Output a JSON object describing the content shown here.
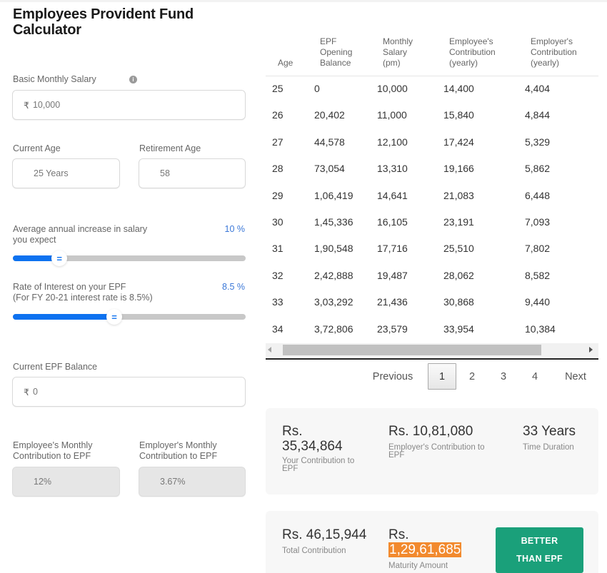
{
  "title": "Employees Provident Fund Calculator",
  "form": {
    "basic_salary": {
      "label": "Basic Monthly Salary",
      "currency": "₹",
      "value": "10,000",
      "info_icon": "i"
    },
    "current_age": {
      "label": "Current Age",
      "value": "25 Years"
    },
    "retirement_age": {
      "label": "Retirement Age",
      "value": "58"
    },
    "salary_increase": {
      "label_line1": "Average annual increase in salary",
      "label_line2": "you expect",
      "value_text": "10 %",
      "value": 10
    },
    "interest_rate": {
      "label_line1": "Rate of Interest on your EPF",
      "label_line2": "(For FY 20-21 interest rate is 8.5%)",
      "value_text": "8.5 %",
      "value": 8.5
    },
    "current_balance": {
      "label": "Current EPF Balance",
      "currency": "₹",
      "value": "0"
    },
    "employee_contribution": {
      "label_line1": "Employee's Monthly",
      "label_line2": "Contribution to EPF",
      "value": "12%"
    },
    "employer_contribution": {
      "label_line1": "Employer's Monthly",
      "label_line2": "Contribution to EPF",
      "value": "3.67%"
    }
  },
  "table": {
    "headers": [
      [
        "Age"
      ],
      [
        "EPF",
        "Opening",
        "Balance"
      ],
      [
        "Monthly",
        "Salary",
        "(pm)"
      ],
      [
        "Employee's",
        "Contribution",
        "(yearly)"
      ],
      [
        "Employer's",
        "Contribution",
        "(yearly)"
      ]
    ],
    "rows": [
      [
        "25",
        "0",
        "10,000",
        "14,400",
        "4,404"
      ],
      [
        "26",
        "20,402",
        "11,000",
        "15,840",
        "4,844"
      ],
      [
        "27",
        "44,578",
        "12,100",
        "17,424",
        "5,329"
      ],
      [
        "28",
        "73,054",
        "13,310",
        "19,166",
        "5,862"
      ],
      [
        "29",
        "1,06,419",
        "14,641",
        "21,083",
        "6,448"
      ],
      [
        "30",
        "1,45,336",
        "16,105",
        "23,191",
        "7,093"
      ],
      [
        "31",
        "1,90,548",
        "17,716",
        "25,510",
        "7,802"
      ],
      [
        "32",
        "2,42,888",
        "19,487",
        "28,062",
        "8,582"
      ],
      [
        "33",
        "3,03,292",
        "21,436",
        "30,868",
        "9,440"
      ],
      [
        "34",
        "3,72,806",
        "23,579",
        "33,954",
        "10,384"
      ]
    ]
  },
  "pagination": {
    "previous": "Previous",
    "pages": [
      "1",
      "2",
      "3",
      "4"
    ],
    "current": "1",
    "next": "Next"
  },
  "summary": {
    "your_contribution": {
      "prefix": "Rs.",
      "amount": "35,34,864",
      "label_line1": "Your Contribution to",
      "label_line2": "EPF"
    },
    "employer_contribution": {
      "value": "Rs. 10,81,080",
      "label_line1": "Employer's Contribution to",
      "label_line2": "EPF"
    },
    "duration": {
      "value": "33 Years",
      "label": "Time Duration"
    },
    "total": {
      "value": "Rs. 46,15,944",
      "label": "Total Contribution"
    },
    "maturity": {
      "prefix": "Rs.",
      "amount": "1,29,61,685",
      "label": "Maturity Amount"
    },
    "better_button": {
      "line1": "BETTER",
      "line2": "THAN EPF"
    }
  },
  "colors": {
    "accent_blue": "#0d72f0",
    "value_blue": "#3b78d8",
    "highlight_orange": "#f28a2e",
    "button_green": "#1aa07a"
  }
}
